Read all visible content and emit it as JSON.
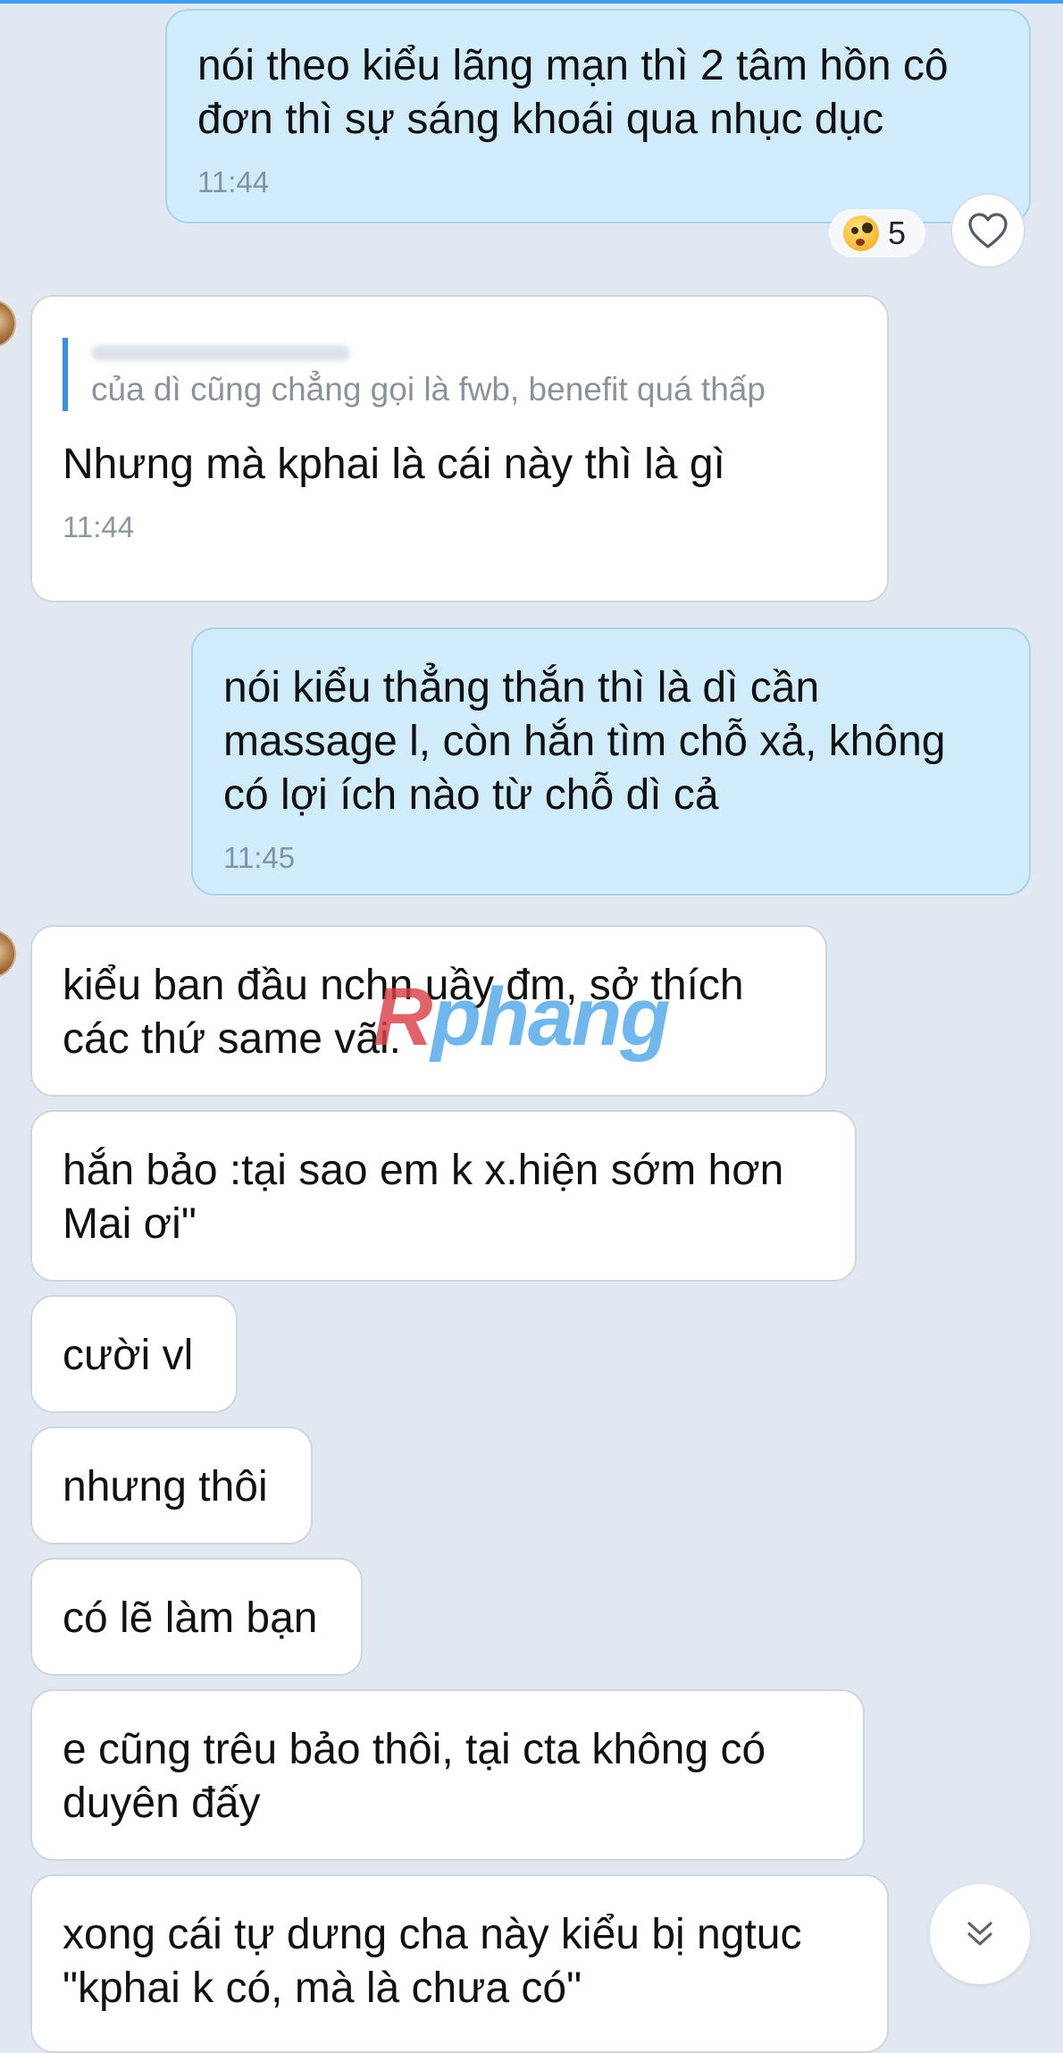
{
  "messages": [
    {
      "text": "nói theo kiểu lãng mạn thì 2 tâm hồn cô đơn thì sự sáng khoái qua nhục dục",
      "time": "11:44"
    },
    {
      "quote": "của dì cũng chẳng gọi là fwb, benefit quá thấp",
      "text": "Nhưng mà kphai là cái này thì là gì",
      "time": "11:44"
    },
    {
      "text": "nói kiểu thẳng thắn thì là dì cần massage l, còn hắn tìm chỗ xả, không có lợi ích nào từ chỗ dì cả",
      "time": "11:45"
    },
    {
      "text": "kiểu ban đầu nchn uầy đm, sở thích các thứ same vãi."
    },
    {
      "text": "hắn bảo :tại sao em k x.hiện sớm hơn Mai ơi\""
    },
    {
      "text": "cười vl"
    },
    {
      "text": "nhưng thôi"
    },
    {
      "text": "có lẽ làm bạn"
    },
    {
      "text": "e cũng trêu bảo thôi, tại cta không có duyên đấy"
    },
    {
      "text": "xong cái tự dưng cha này kiểu bị ngtuc \"kphai k có, mà là chưa có\""
    }
  ],
  "reaction": {
    "emoji": "face-with-monocle",
    "count": "5"
  },
  "watermark": {
    "first": "R",
    "rest": "phang"
  },
  "icons": {
    "like": "heart-outline-icon",
    "scroll": "double-chevron-down-icon"
  },
  "colors": {
    "background": "#e2e8f1",
    "outgoing_bubble": "#d0ecfb",
    "incoming_bubble": "#ffffff",
    "quote_bar": "#3b8ee8"
  }
}
